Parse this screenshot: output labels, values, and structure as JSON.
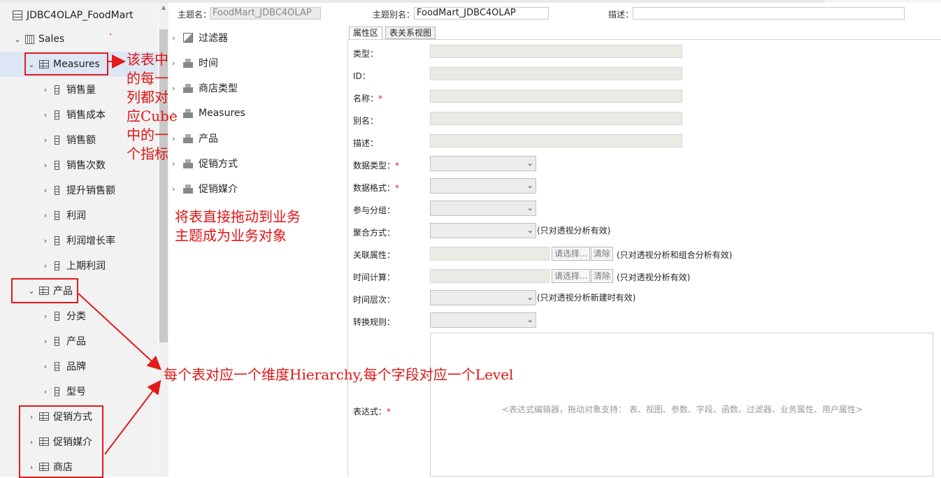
{
  "left_tree": {
    "root": "JDBC4OLAP_FoodMart",
    "cube": "Sales",
    "measures_table": "Measures",
    "measures": [
      "销售量",
      "销售成本",
      "销售额",
      "销售次数",
      "提升销售额",
      "利润",
      "利润增长率",
      "上期利润"
    ],
    "product_table": "产品",
    "product_fields": [
      "分类",
      "产品",
      "品牌",
      "型号"
    ],
    "other_tables": [
      "促销方式",
      "促销媒介",
      "商店"
    ]
  },
  "header": {
    "subject_name_label": "主题名：",
    "subject_name_value": "FoodMart_JDBC4OLAP",
    "subject_alias_label": "主题别名：",
    "subject_alias_value": "FoodMart_JDBC4OLAP",
    "description_label": "描述：",
    "description_value": ""
  },
  "subject_tree": {
    "filter": "过滤器",
    "folders": [
      "时间",
      "商店类型",
      "Measures",
      "产品",
      "促销方式",
      "促销媒介"
    ]
  },
  "tabs": [
    "属性区",
    "表关系视图"
  ],
  "properties": {
    "type": "类型：",
    "id": "ID：",
    "name": "名称：",
    "alias": "别名：",
    "desc": "描述：",
    "data_type": "数据类型：",
    "data_format": "数据格式：",
    "group": "参与分组：",
    "aggregate": "聚合方式：",
    "aggregate_note": "(只对透视分析有效)",
    "related": "关联属性：",
    "related_note": "(只对透视分析和组合分析有效)",
    "time_calc": "时间计算：",
    "time_calc_note": "(只对透视分析有效)",
    "time_level": "时间层次：",
    "time_level_note": "(只对透视分析新建时有效)",
    "convert_rule": "转换规则：",
    "expression": "表达式：",
    "required_mark": "*",
    "select_btn": "请选择...",
    "clear_btn": "清除",
    "expr_placeholder": "<表达式编辑器，拖动对象支持： 表、视图、参数、字段、函数、过滤器、业务属性、用户属性>"
  },
  "annotations": {
    "measures_note": [
      "该表中",
      "的每一",
      "列都对",
      "应Cube",
      "中的一",
      "个指标"
    ],
    "drag_note": [
      "将表直接拖动到业务",
      "主题成为业务对象"
    ],
    "hierarchy_note": "每个表对应一个维度Hierarchy,每个字段对应一个Level"
  },
  "colors": {
    "annotation_red": "#e21b1b",
    "selected_row": "#dce6f4"
  }
}
